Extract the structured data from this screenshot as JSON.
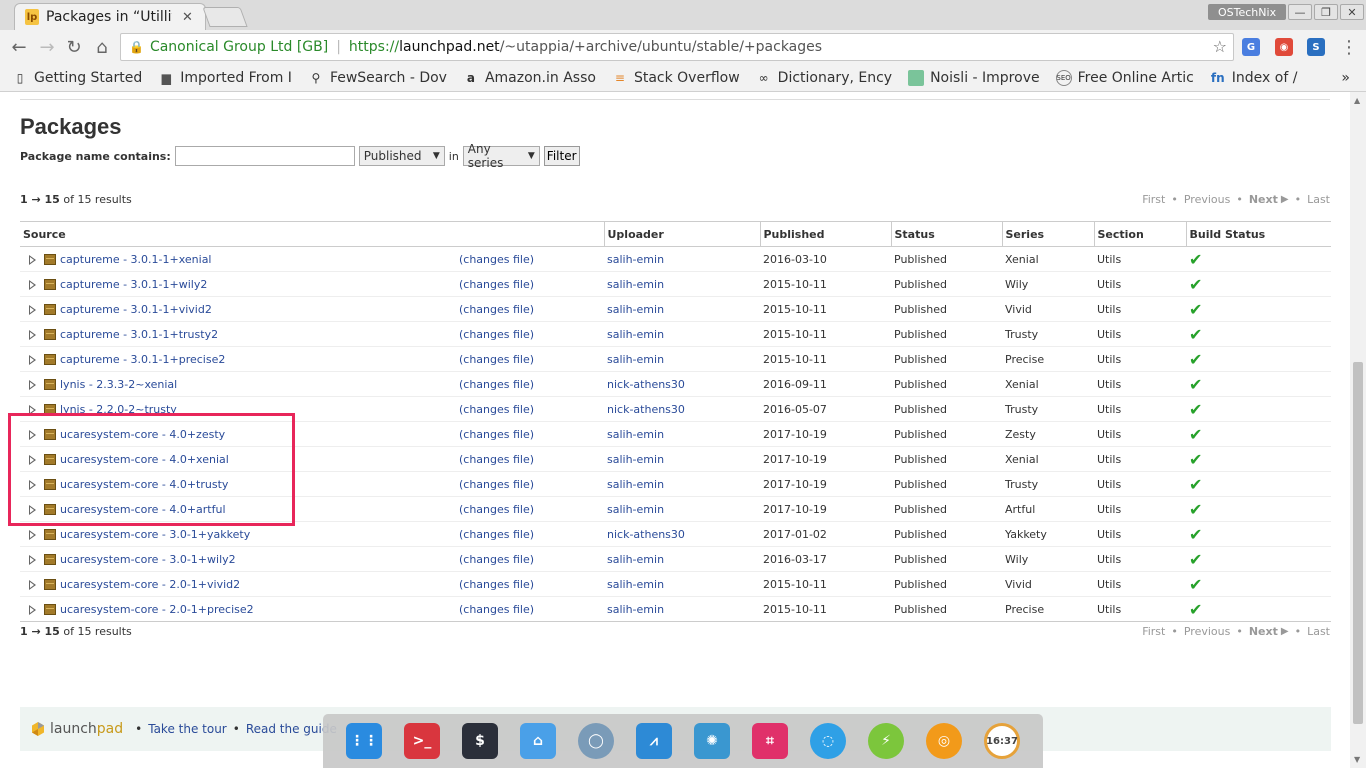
{
  "browser": {
    "tab_title": "Packages in “Utilliti",
    "tab_favicon": "lp",
    "profile_name": "OSTechNix",
    "omnibox": {
      "org": "Canonical Group Ltd [GB]",
      "protocol": "https://",
      "host": "launchpad.net",
      "path": "/~utappia/+archive/ubuntu/stable/+packages"
    },
    "bookmarks": [
      {
        "label": "Getting Started",
        "icon": "page-icon"
      },
      {
        "label": "Imported From I",
        "icon": "folder-icon"
      },
      {
        "label": "FewSearch - Dov",
        "icon": "search-icon"
      },
      {
        "label": "Amazon.in Asso",
        "icon": "amazon-icon"
      },
      {
        "label": "Stack Overflow",
        "icon": "stackoverflow-icon"
      },
      {
        "label": "Dictionary, Ency",
        "icon": "dictionary-icon"
      },
      {
        "label": "Noisli - Improve",
        "icon": "noisli-icon"
      },
      {
        "label": "Free Online Artic",
        "icon": "seo-icon"
      },
      {
        "label": "Index of /",
        "icon": "fn-icon"
      }
    ],
    "bookmarks_overflow": "»"
  },
  "page": {
    "title": "Packages",
    "filter": {
      "label": "Package name contains:",
      "input_value": "",
      "status_select": "Published",
      "in_label": "in",
      "series_select": "Any series",
      "button": "Filter"
    },
    "results_top": {
      "range": "1 → 15",
      "of_text": " of 15 results"
    },
    "results_bottom": {
      "range": "1 → 15",
      "of_text": " of 15 results"
    },
    "pager": {
      "first": "First",
      "previous": "Previous",
      "next": "Next",
      "last": "Last"
    },
    "table": {
      "headers": [
        "Source",
        "Uploader",
        "Published",
        "Status",
        "Series",
        "Section",
        "Build Status"
      ],
      "changes_label": "(changes file)",
      "rows": [
        {
          "source": "captureme - 3.0.1-1+xenial",
          "uploader": "salih-emin",
          "published": "2016-03-10",
          "status": "Published",
          "series": "Xenial",
          "section": "Utils"
        },
        {
          "source": "captureme - 3.0.1-1+wily2",
          "uploader": "salih-emin",
          "published": "2015-10-11",
          "status": "Published",
          "series": "Wily",
          "section": "Utils"
        },
        {
          "source": "captureme - 3.0.1-1+vivid2",
          "uploader": "salih-emin",
          "published": "2015-10-11",
          "status": "Published",
          "series": "Vivid",
          "section": "Utils"
        },
        {
          "source": "captureme - 3.0.1-1+trusty2",
          "uploader": "salih-emin",
          "published": "2015-10-11",
          "status": "Published",
          "series": "Trusty",
          "section": "Utils"
        },
        {
          "source": "captureme - 3.0.1-1+precise2",
          "uploader": "salih-emin",
          "published": "2015-10-11",
          "status": "Published",
          "series": "Precise",
          "section": "Utils"
        },
        {
          "source": "lynis - 2.3.3-2~xenial",
          "uploader": "nick-athens30",
          "published": "2016-09-11",
          "status": "Published",
          "series": "Xenial",
          "section": "Utils"
        },
        {
          "source": "lynis - 2.2.0-2~trusty",
          "uploader": "nick-athens30",
          "published": "2016-05-07",
          "status": "Published",
          "series": "Trusty",
          "section": "Utils"
        },
        {
          "source": "ucaresystem-core - 4.0+zesty",
          "uploader": "salih-emin",
          "published": "2017-10-19",
          "status": "Published",
          "series": "Zesty",
          "section": "Utils"
        },
        {
          "source": "ucaresystem-core - 4.0+xenial",
          "uploader": "salih-emin",
          "published": "2017-10-19",
          "status": "Published",
          "series": "Xenial",
          "section": "Utils"
        },
        {
          "source": "ucaresystem-core - 4.0+trusty",
          "uploader": "salih-emin",
          "published": "2017-10-19",
          "status": "Published",
          "series": "Trusty",
          "section": "Utils"
        },
        {
          "source": "ucaresystem-core - 4.0+artful",
          "uploader": "salih-emin",
          "published": "2017-10-19",
          "status": "Published",
          "series": "Artful",
          "section": "Utils"
        },
        {
          "source": "ucaresystem-core - 3.0-1+yakkety",
          "uploader": "nick-athens30",
          "published": "2017-01-02",
          "status": "Published",
          "series": "Yakkety",
          "section": "Utils"
        },
        {
          "source": "ucaresystem-core - 3.0-1+wily2",
          "uploader": "salih-emin",
          "published": "2016-03-17",
          "status": "Published",
          "series": "Wily",
          "section": "Utils"
        },
        {
          "source": "ucaresystem-core - 2.0-1+vivid2",
          "uploader": "salih-emin",
          "published": "2015-10-11",
          "status": "Published",
          "series": "Vivid",
          "section": "Utils"
        },
        {
          "source": "ucaresystem-core - 2.0-1+precise2",
          "uploader": "salih-emin",
          "published": "2015-10-11",
          "status": "Published",
          "series": "Precise",
          "section": "Utils"
        }
      ]
    },
    "footer": {
      "brand_prefix": "launch",
      "brand_suffix": "pad",
      "tour": "Take the tour",
      "guide": "Read the guide"
    }
  },
  "dock": {
    "apps": [
      {
        "name": "launcher-icon",
        "color": "#2a8be0",
        "glyph": "⋮⋮"
      },
      {
        "name": "terminal-red-icon",
        "color": "#d9363e",
        "glyph": ">_"
      },
      {
        "name": "terminal-icon",
        "color": "#2b2f3a",
        "glyph": "$"
      },
      {
        "name": "files-icon",
        "color": "#4aa0e8",
        "glyph": "⌂"
      },
      {
        "name": "chromium-icon",
        "color": "#7a9bb8",
        "glyph": "◯"
      },
      {
        "name": "system-monitor-icon",
        "color": "#2d8ad6",
        "glyph": "⩘"
      },
      {
        "name": "shutter-icon",
        "color": "#3a97d0",
        "glyph": "✺"
      },
      {
        "name": "crop-icon",
        "color": "#e0306a",
        "glyph": "⌗"
      },
      {
        "name": "deepin-icon",
        "color": "#2fa0e6",
        "glyph": "◌"
      },
      {
        "name": "power-icon",
        "color": "#7cc63c",
        "glyph": "⚡"
      },
      {
        "name": "qq-icon",
        "color": "#f29a1a",
        "glyph": "◎"
      },
      {
        "name": "clock-icon",
        "color": "#444444",
        "glyph": "16:37"
      }
    ]
  }
}
